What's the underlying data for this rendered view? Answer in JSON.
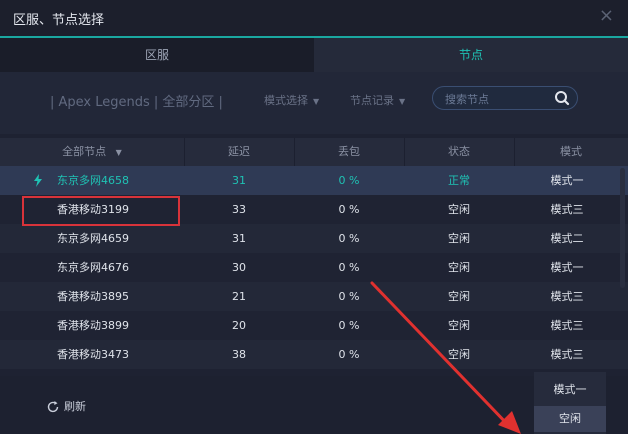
{
  "window": {
    "title": "区服、节点选择",
    "close": "×"
  },
  "tabs": [
    {
      "label": "区服"
    },
    {
      "label": "节点"
    }
  ],
  "filter": {
    "game": "| Apex Legends | 全部分区 |",
    "mode_label": "模式选择",
    "record_label": "节点记录",
    "search_placeholder": "搜索节点"
  },
  "table": {
    "headers": [
      "全部节点",
      "延迟",
      "丢包",
      "状态",
      "模式"
    ],
    "rows": [
      {
        "name": "东京多网4658",
        "latency": "31",
        "loss": "0 %",
        "status": "正常",
        "mode": "模式一"
      },
      {
        "name": "香港移动3199",
        "latency": "33",
        "loss": "0 %",
        "status": "空闲",
        "mode": "模式三"
      },
      {
        "name": "东京多网4659",
        "latency": "31",
        "loss": "0 %",
        "status": "空闲",
        "mode": "模式二"
      },
      {
        "name": "东京多网4676",
        "latency": "30",
        "loss": "0 %",
        "status": "空闲",
        "mode": "模式一"
      },
      {
        "name": "香港移动3895",
        "latency": "21",
        "loss": "0 %",
        "status": "空闲",
        "mode": "模式三"
      },
      {
        "name": "香港移动3899",
        "latency": "20",
        "loss": "0 %",
        "status": "空闲",
        "mode": "模式三"
      },
      {
        "name": "香港移动3473",
        "latency": "38",
        "loss": "0 %",
        "status": "空闲",
        "mode": "模式三"
      }
    ]
  },
  "footer": {
    "refresh_label": "刷新"
  },
  "mode_popup": [
    {
      "label": "模式一"
    },
    {
      "label": "空闲"
    }
  ],
  "colors": {
    "accent": "#1fc2b4",
    "highlight_box": "#d8333a",
    "annotation_arrow": "#e0312f"
  }
}
